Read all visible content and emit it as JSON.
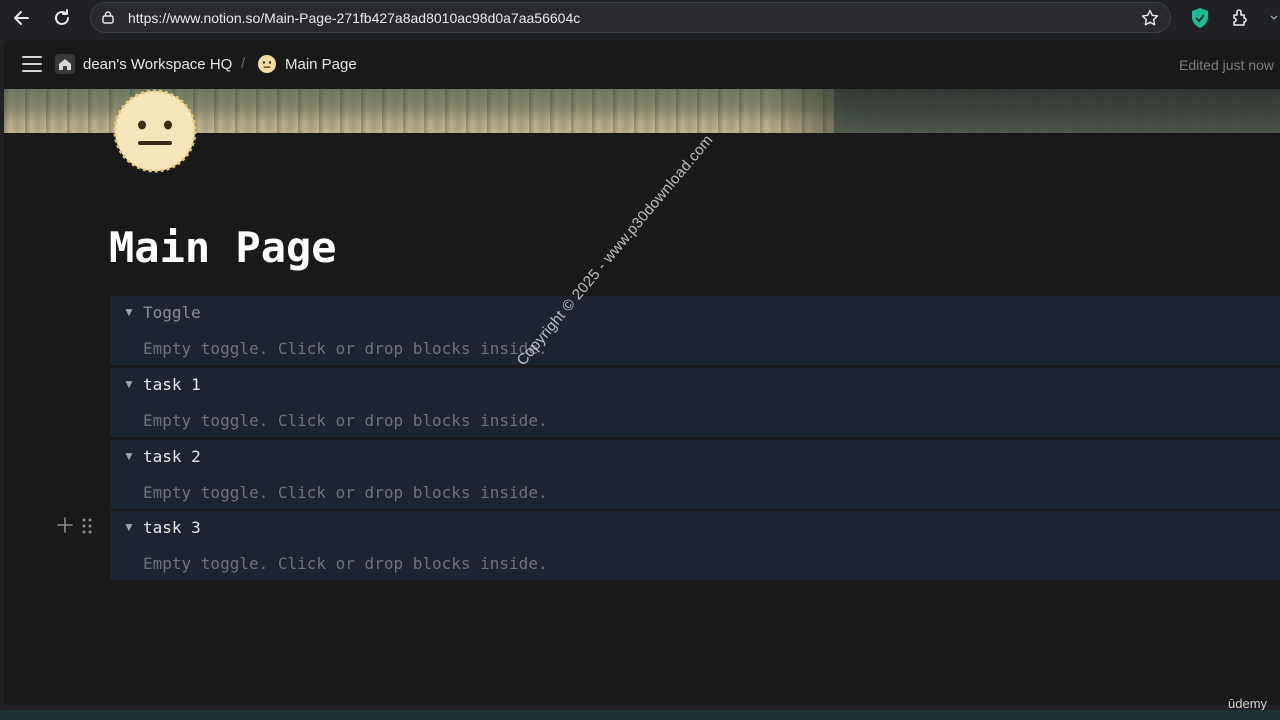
{
  "browser": {
    "url": "https://www.notion.so/Main-Page-271fb427a8ad8010ac98d0a7aa56604c"
  },
  "topbar": {
    "workspace": "dean's Workspace HQ",
    "separator": "/",
    "page": "Main Page",
    "status": "Edited just now"
  },
  "page": {
    "title": "Main Page",
    "toggles": [
      {
        "title": "Toggle",
        "placeholder_title": true,
        "body": "Empty toggle. Click or drop blocks inside."
      },
      {
        "title": "task 1",
        "placeholder_title": false,
        "body": "Empty toggle. Click or drop blocks inside."
      },
      {
        "title": "task 2",
        "placeholder_title": false,
        "body": "Empty toggle. Click or drop blocks inside."
      },
      {
        "title": "task 3",
        "placeholder_title": false,
        "body": "Empty toggle. Click or drop blocks inside."
      }
    ]
  },
  "overlay": {
    "watermark": "Copyright © 2025 - www.p30download.com",
    "brand": "ūdemy"
  },
  "colors": {
    "page_bg": "#191919",
    "toggle_bg": "#1b2532",
    "placeholder_text": "#6e7378"
  }
}
